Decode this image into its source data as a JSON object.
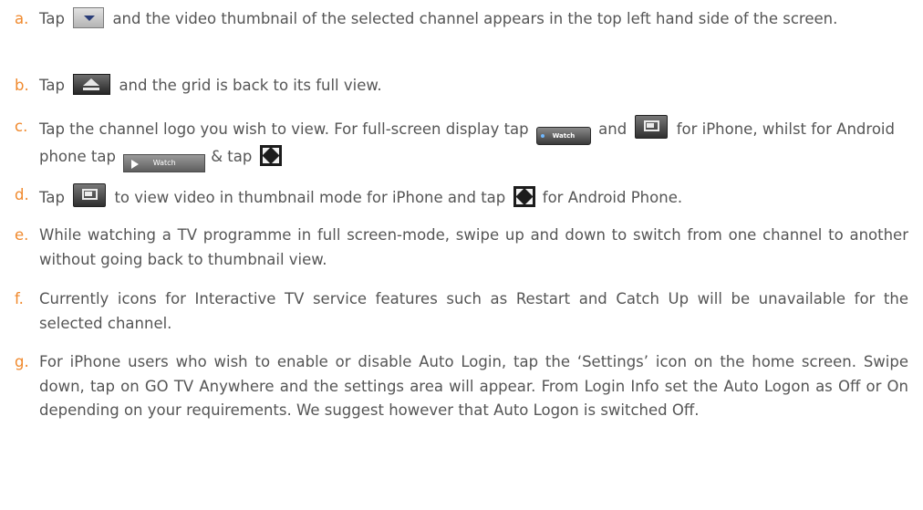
{
  "colors": {
    "marker": "#f0892d",
    "text": "#555555"
  },
  "items": [
    {
      "marker": "a.",
      "t1": "Tap",
      "t2": "and the video thumbnail of the selected channel appears in the top left hand side of the screen."
    },
    {
      "marker": "b.",
      "t1": "Tap",
      "t2": "and the grid is back to its full view."
    },
    {
      "marker": "c.",
      "t1": "Tap the channel logo you wish to view. For full-screen display tap",
      "watch_ios": "Watch",
      "t2": "and",
      "t3": "for iPhone, whilst for Android phone tap",
      "watch_android": "Watch",
      "t4": "& tap"
    },
    {
      "marker": "d.",
      "t1": "Tap",
      "t2": "to view video in thumbnail mode for iPhone and tap",
      "t3": "for Android Phone."
    },
    {
      "marker": "e.",
      "text": "While watching a TV programme in full screen-mode, swipe up and down to switch from one channel to another without going back to thumbnail view."
    },
    {
      "marker": "f.",
      "text": "Currently icons for Interactive TV service features such as Restart and Catch Up will be unavailable for the selected channel."
    },
    {
      "marker": "g.",
      "text": "For iPhone users who wish to enable or disable Auto Login, tap the ‘Settings’ icon on the home screen.  Swipe down, tap on GO TV Anywhere and the settings area will appear. From Login Info set the Auto Logon as Off or On depending on your requirements. We suggest however that Auto Logon is switched Off."
    }
  ]
}
